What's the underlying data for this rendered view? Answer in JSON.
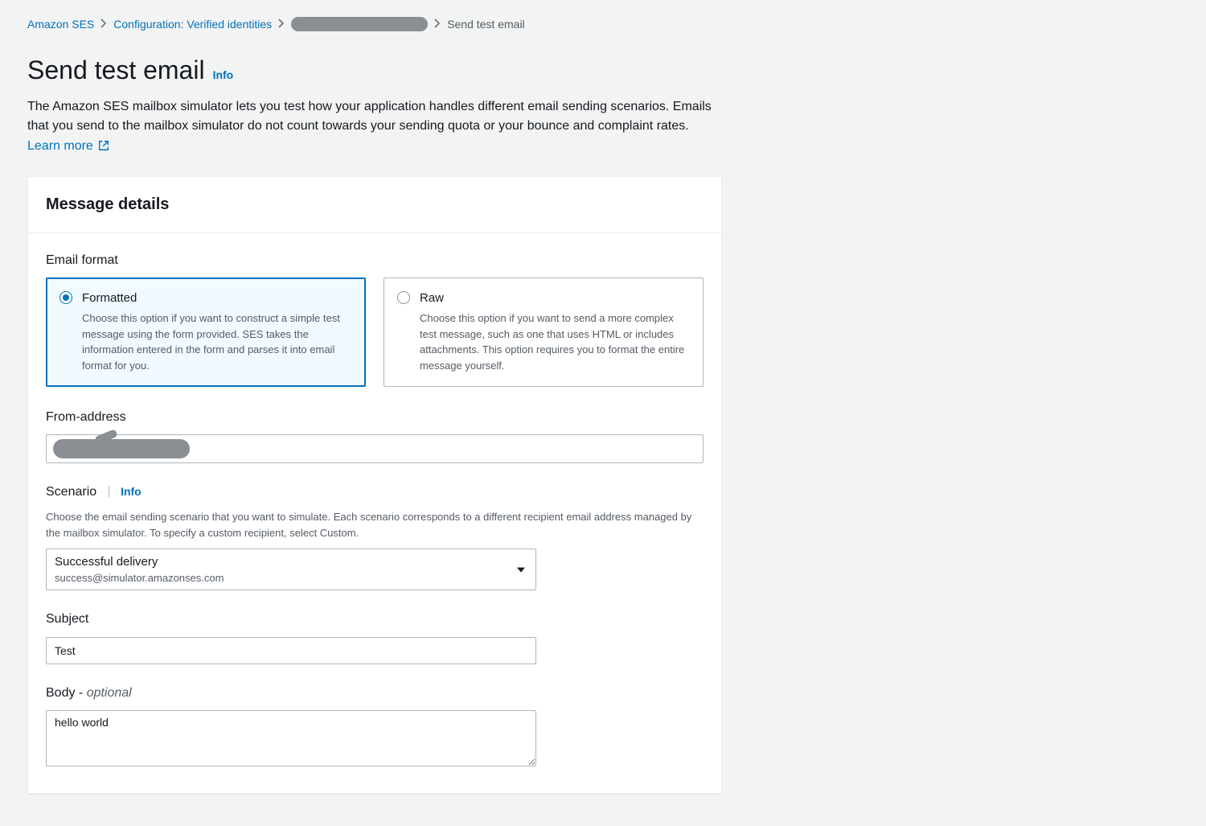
{
  "breadcrumb": {
    "service": "Amazon SES",
    "config": "Configuration: Verified identities",
    "current": "Send test email"
  },
  "header": {
    "title": "Send test email",
    "info": "Info",
    "description": "The Amazon SES mailbox simulator lets you test how your application handles different email sending scenarios. Emails that you send to the mailbox simulator do not count towards your sending quota or your bounce and complaint rates. ",
    "learn_more": "Learn more"
  },
  "panel": {
    "title": "Message details",
    "email_format": {
      "label": "Email format",
      "formatted": {
        "title": "Formatted",
        "desc": "Choose this option if you want to construct a simple test message using the form provided. SES takes the information entered in the form and parses it into email format for you."
      },
      "raw": {
        "title": "Raw",
        "desc": "Choose this option if you want to send a more complex test message, such as one that uses HTML or includes attachments. This option requires you to format the entire message yourself."
      }
    },
    "from_address": {
      "label": "From-address"
    },
    "scenario": {
      "label": "Scenario",
      "info": "Info",
      "desc": "Choose the email sending scenario that you want to simulate. Each scenario corresponds to a different recipient email address managed by the mailbox simulator. To specify a custom recipient, select Custom.",
      "selected": "Successful delivery",
      "selected_sub": "success@simulator.amazonses.com"
    },
    "subject": {
      "label": "Subject",
      "value": "Test"
    },
    "body": {
      "label": "Body - ",
      "optional": "optional",
      "value": "hello world"
    }
  }
}
